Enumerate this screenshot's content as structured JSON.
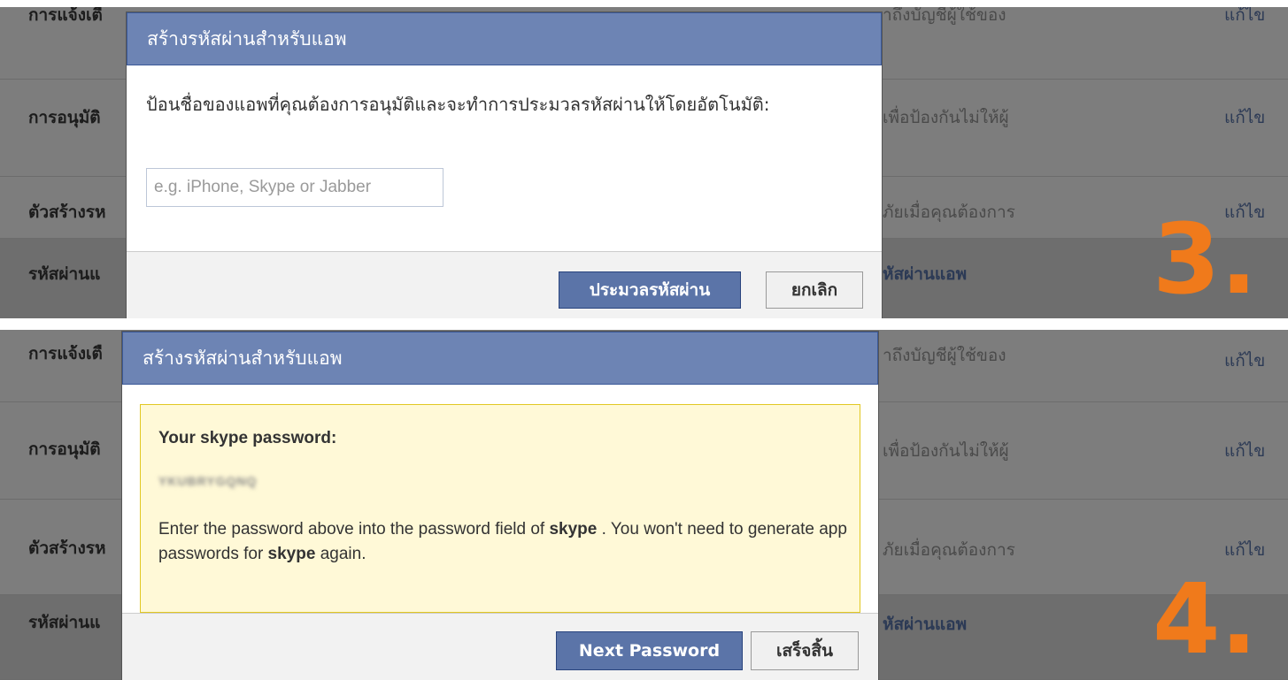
{
  "background": {
    "rows": [
      {
        "label": "การแจ้งเตื",
        "desc": "าถึงบัญชีผู้ใช้ของ",
        "edit": "แก้ไข"
      },
      {
        "label": "การอนุมัติ",
        "desc": "เพื่อป้องกันไม่ให้ผู้",
        "edit": "แก้ไข"
      },
      {
        "label": "ตัวสร้างรห",
        "desc": "ภัยเมื่อคุณต้องการ",
        "edit": "แก้ไข"
      },
      {
        "label": "รหัสผ่านแ",
        "link": "หัสผ่านแอพ"
      }
    ]
  },
  "step_top": "3.",
  "step_bottom": "4.",
  "dialog_create": {
    "title": "สร้างรหัสผ่านสำหรับแอพ",
    "prompt": "ป้อนชื่อของแอพที่คุณต้องการอนุมัติและจะทำการประมวลรหัสผ่านให้โดยอัตโนมัติ:",
    "input_value": "",
    "input_placeholder": "e.g. iPhone, Skype or Jabber",
    "generate_label": "ประมวลรหัสผ่าน",
    "cancel_label": "ยกเลิก"
  },
  "dialog_result": {
    "title": "สร้างรหัสผ่านสำหรับแอพ",
    "heading": "Your skype password:",
    "password": "YKUBRYGQNQ",
    "message_part1": "Enter the password above into the password field of ",
    "app_name": "skype",
    "message_part2": " . You won't need to generate app passwords for ",
    "message_part3": " again.",
    "next_label": "Next Password",
    "done_label": "เสร็จสิ้น"
  },
  "colors": {
    "dialog_header": "#6d84b4",
    "primary_button": "#5b74a8",
    "step_number": "#f07a1b",
    "result_box": "#fff9d7"
  }
}
